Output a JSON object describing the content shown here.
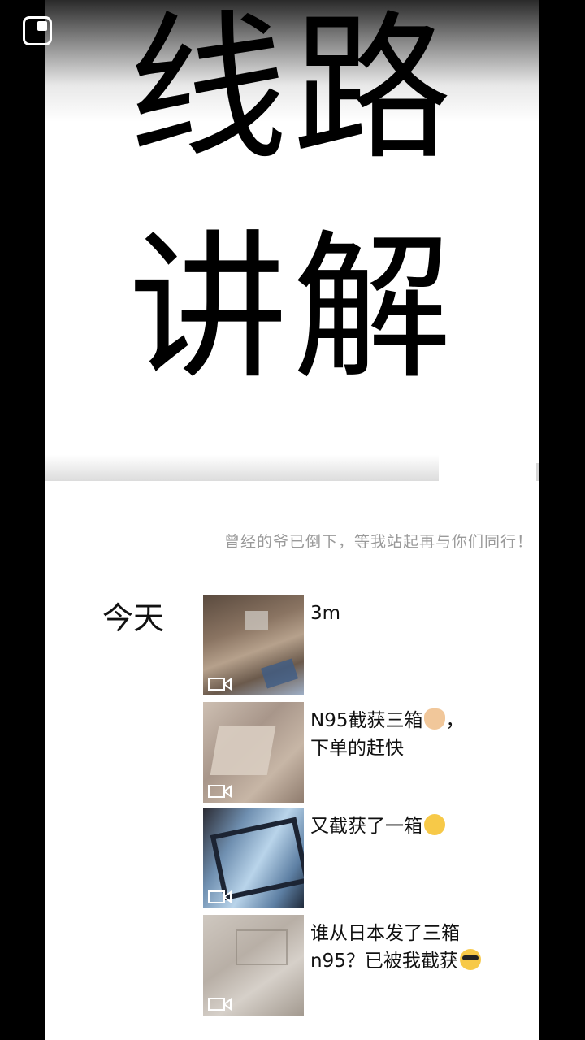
{
  "overlay": {
    "pip_icon": "picture-in-picture-icon"
  },
  "banner": {
    "line1": "线路",
    "line2": "讲解",
    "link_icon": "link-icon"
  },
  "profile": {
    "signature": "曾经的爷已倒下，等我站起再与你们同行！"
  },
  "feed": {
    "day_label": "今天",
    "posts": [
      {
        "caption_lines": [
          "3m"
        ],
        "media": "video-thumbnail",
        "emoji": ""
      },
      {
        "caption_lines": [
          "N95截获三箱",
          "下单的赶快"
        ],
        "emoji": "victory-hand-emoji",
        "emoji_after_line1": "，"
      },
      {
        "caption_lines": [
          "又截获了一箱"
        ],
        "emoji": "grinning-face-emoji"
      },
      {
        "caption_lines": [
          "谁从日本发了三箱",
          "n95？已被我截获"
        ],
        "emoji": "sunglasses-face-emoji"
      }
    ]
  },
  "colors": {
    "background": "#000000",
    "page": "#ffffff",
    "muted_text": "#9a9a9a"
  }
}
